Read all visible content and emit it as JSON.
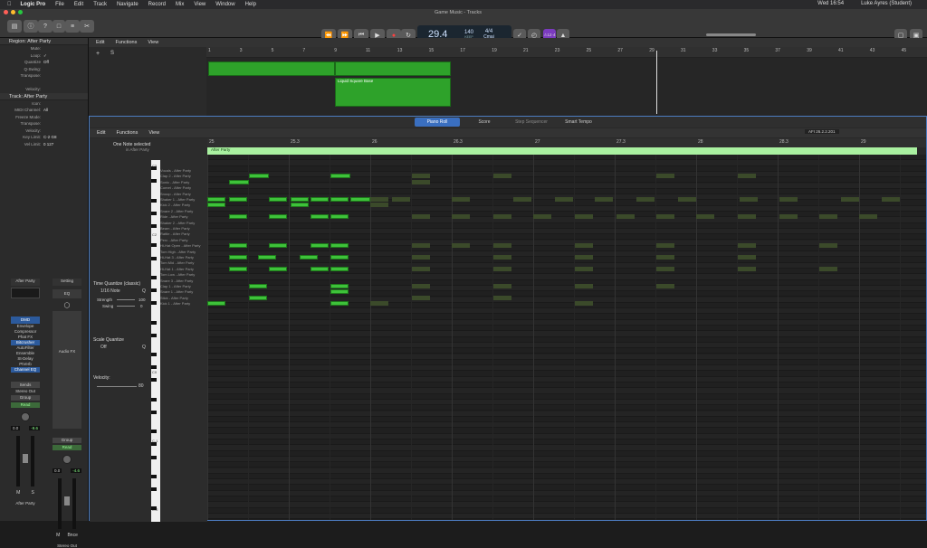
{
  "menubar": {
    "app": "Logic Pro",
    "items": [
      "File",
      "Edit",
      "Track",
      "Navigate",
      "Record",
      "Mix",
      "View",
      "Window",
      "Help"
    ],
    "clock": "Wed 16:54",
    "user": "Luke Ayres (Student)"
  },
  "window": {
    "title": "Game Music - Tracks"
  },
  "lcd": {
    "position": "29.4",
    "tempo": "140",
    "tempo_label": "KEEP",
    "signature": "4/4",
    "key": "Cmaj"
  },
  "toolbar": {
    "count_in": "⚠12·4"
  },
  "inspector": {
    "region_header": "Region: After Party",
    "region_params": [
      {
        "k": "Mute:",
        "v": ""
      },
      {
        "k": "Loop:",
        "v": "✓"
      },
      {
        "k": "Quantize",
        "v": "Off"
      },
      {
        "k": "Q-Swing:",
        "v": ""
      },
      {
        "k": "Transpose:",
        "v": ""
      },
      {
        "k": "",
        "v": ""
      },
      {
        "k": "Velocity:",
        "v": ""
      }
    ],
    "track_header": "Track: After Party",
    "track_params": [
      {
        "k": "Icon:",
        "v": ""
      },
      {
        "k": "MIDI Channel:",
        "v": "All"
      },
      {
        "k": "Freeze Mode:",
        "v": ""
      },
      {
        "k": "Transpose:",
        "v": ""
      },
      {
        "k": "Velocity:",
        "v": ""
      },
      {
        "k": "Key Limit:",
        "v": "C-2  G8"
      },
      {
        "k": "Vel Limit:",
        "v": "0  127"
      }
    ],
    "strip1": {
      "name": "After Party",
      "eq": "DMD",
      "plugins": [
        {
          "label": "Envelope",
          "on": false
        },
        {
          "label": "Compressor",
          "on": false
        },
        {
          "label": "Phat FX",
          "on": false
        },
        {
          "label": "Bitcrusher",
          "on": true
        },
        {
          "label": "AutoFilter",
          "on": false
        },
        {
          "label": "Ensemble",
          "on": false
        },
        {
          "label": "St-Delay",
          "on": false
        },
        {
          "label": "PtVerb",
          "on": false
        },
        {
          "label": "Channel EQ",
          "on": true
        }
      ],
      "send": "Stereo Out",
      "group": "Group",
      "read": "Read",
      "vol": "0.0",
      "pan": "-9.6",
      "bottom": "After Party"
    },
    "strip2": {
      "name": "Setting",
      "eq": "EQ",
      "audiofx": "Audio FX",
      "group": "Group",
      "read": "Read",
      "vol": "0.0",
      "pan": "-4.6",
      "bnce": "Bnce",
      "bottom": "Stereo Out"
    }
  },
  "tracks": {
    "menu": {
      "edit": "Edit",
      "functions": "Functions",
      "view": "View"
    },
    "bars": [
      "1",
      "3",
      "5",
      "7",
      "9",
      "11",
      "13",
      "15",
      "17",
      "19",
      "21",
      "23",
      "25",
      "27",
      "29",
      "31",
      "33",
      "35",
      "37",
      "39",
      "41",
      "43",
      "45"
    ],
    "region_label": "Liquid Square Base"
  },
  "piano_roll": {
    "tabs": [
      "Piano Roll",
      "Score",
      "Step Sequencer",
      "Smart Tempo"
    ],
    "menu": {
      "edit": "Edit",
      "functions": "Functions",
      "view": "View"
    },
    "position": "AFI  26.2.2.201",
    "selection_line1": "One Note selected",
    "selection_line2": "in After Party",
    "time_quantize": "Time Quantize (classic)",
    "quantize_value": "1/16 Note",
    "strength_label": "Strength",
    "strength": "100",
    "swing_label": "Swing",
    "swing": "0",
    "scale_quantize": "Scale Quantize",
    "scale_value": "Off",
    "velocity_label": "Velocity:",
    "velocity": "80",
    "ruler": [
      "25",
      "25.3",
      "26",
      "26.3",
      "27",
      "27.3",
      "28",
      "28.3",
      "29"
    ],
    "region_name": "After Party",
    "key_labels": [
      "C3",
      "C2",
      "C1",
      "C0",
      "C-1",
      "C-2"
    ],
    "lanes": [
      "Vocals - After Party",
      "Clap 2 - After Party",
      "Sonic - After Party",
      "Comet - After Party",
      "Snoop - After Party",
      "Shaker 1 - After Party",
      "Kick 2 - After Party",
      "Snare 2 - After Party",
      "Ride - After Party",
      "Shaker 2 - After Party",
      "Beam - After Party",
      "Rattle - After Party",
      "Perc - After Party",
      "Hi-Hat Open - After Party",
      "Tom High - After Party",
      "Hi-Hat 3 - After Party",
      "Tom Mid - After Party",
      "Hi-Hat 1 - After Party",
      "Tom Low - After Party",
      "Snare 3 - After Party",
      "Clap 1 - After Party",
      "Snare 1 - After Party",
      "Stick - After Party",
      "Kick 1 - After Party"
    ]
  }
}
